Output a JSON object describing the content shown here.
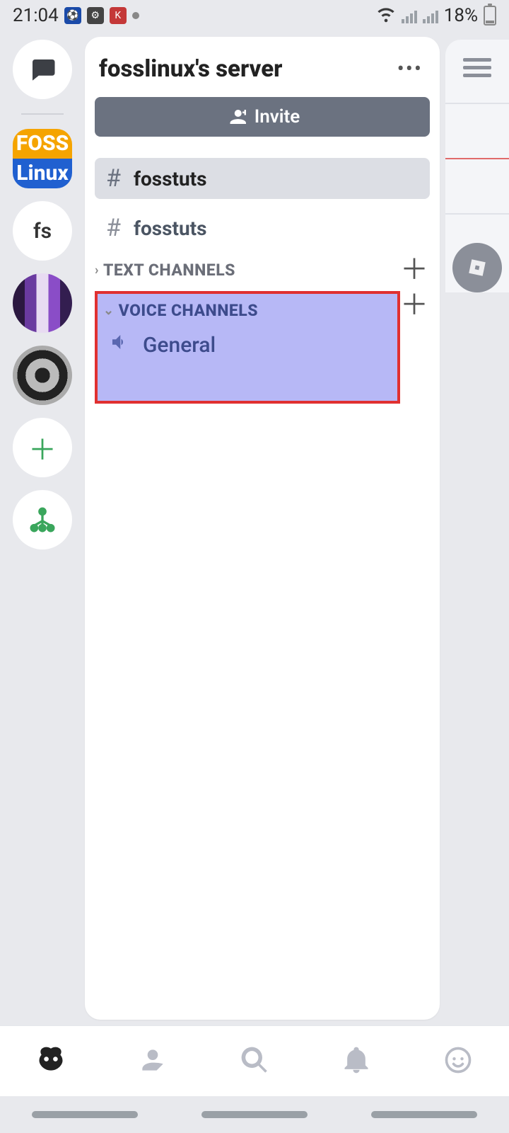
{
  "status": {
    "time": "21:04",
    "battery": "18%"
  },
  "server_rail": {
    "fs_label": "fs",
    "foss_top_label": "FOSS",
    "foss_bot_label": "Linux"
  },
  "panel": {
    "title": "fosslinux's server",
    "invite_label": "Invite"
  },
  "channels": {
    "selected_name": "fosstuts",
    "second_name": "fosstuts"
  },
  "categories": {
    "text_label": "TEXT CHANNELS",
    "voice_label": "VOICE CHANNELS"
  },
  "voice": {
    "general_label": "General"
  }
}
